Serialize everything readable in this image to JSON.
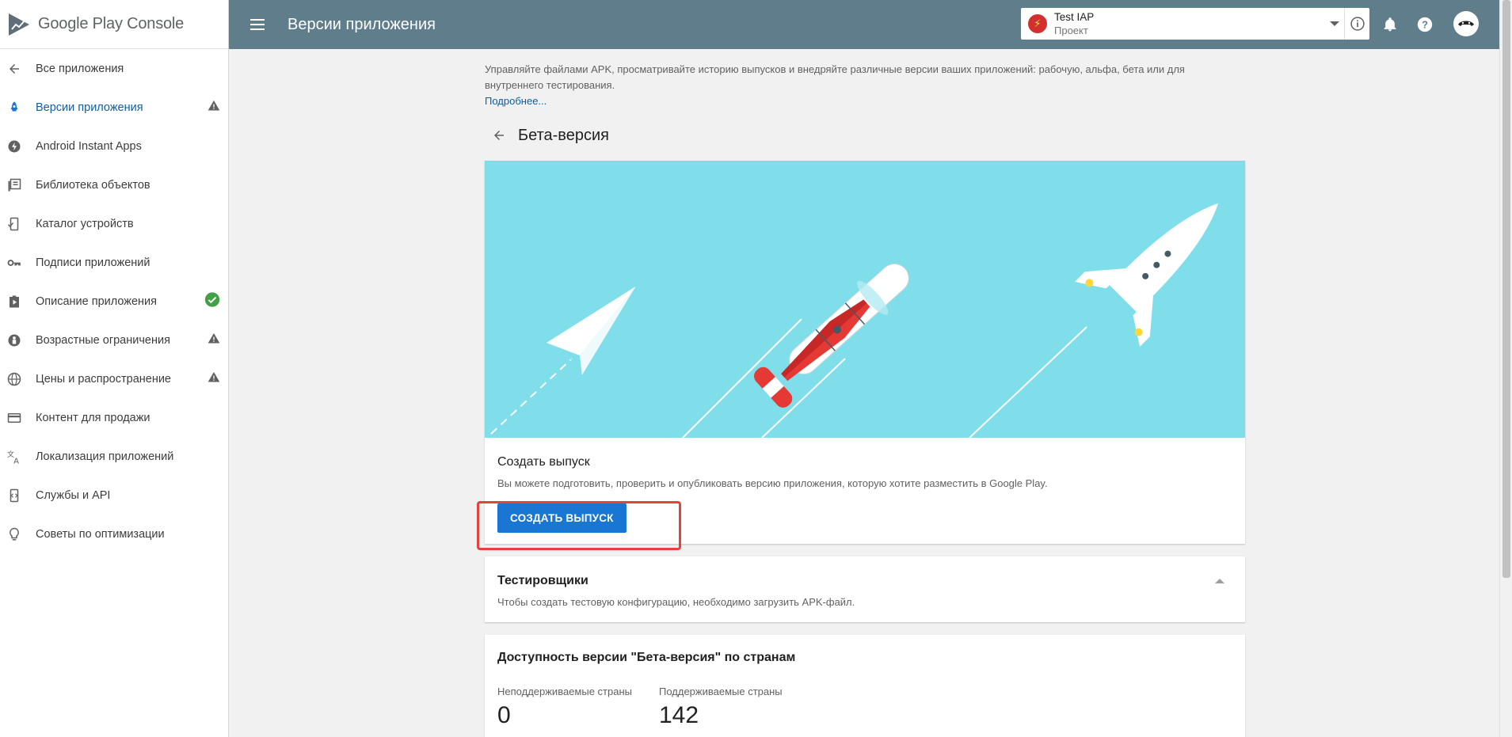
{
  "app": {
    "logo_text": "Google Play Console"
  },
  "topbar": {
    "title": "Версии приложения"
  },
  "project": {
    "name": "Test IAP",
    "subtitle": "Проект"
  },
  "sidebar": {
    "items": [
      {
        "label": "Все приложения",
        "icon": "arrow-left-icon"
      },
      {
        "label": "Версии приложения",
        "icon": "rocket-icon",
        "status": "warning"
      },
      {
        "label": "Android Instant Apps",
        "icon": "bolt-icon"
      },
      {
        "label": "Библиотека объектов",
        "icon": "library-icon"
      },
      {
        "label": "Каталог устройств",
        "icon": "device-check-icon"
      },
      {
        "label": "Подписи приложений",
        "icon": "key-icon"
      },
      {
        "label": "Описание приложения",
        "icon": "store-listing-icon",
        "status": "ok"
      },
      {
        "label": "Возрастные ограничения",
        "icon": "content-rating-icon",
        "status": "warning"
      },
      {
        "label": "Цены и распространение",
        "icon": "globe-icon",
        "status": "warning"
      },
      {
        "label": "Контент для продажи",
        "icon": "credit-card-icon"
      },
      {
        "label": "Локализация приложений",
        "icon": "translate-icon"
      },
      {
        "label": "Службы и API",
        "icon": "services-icon"
      },
      {
        "label": "Советы по оптимизации",
        "icon": "lightbulb-icon"
      }
    ]
  },
  "main": {
    "intro": "Управляйте файлами APK, просматривайте историю выпусков и внедряйте различные версии ваших приложений: рабочую, альфа, бета или для внутреннего тестирования.",
    "more_link": "Подробнее...",
    "page_title": "Бета-версия",
    "release": {
      "title": "Создать выпуск",
      "description": "Вы можете подготовить, проверить и опубликовать версию приложения, которую хотите разместить в Google Play.",
      "button": "Создать выпуск"
    },
    "testers": {
      "title": "Тестировщики",
      "description": "Чтобы создать тестовую конфигурацию, необходимо загрузить APK-файл."
    },
    "availability": {
      "title": "Доступность версии \"Бета-версия\" по странам",
      "unsupported_label": "Неподдерживаемые страны",
      "unsupported_value": "0",
      "supported_label": "Поддерживаемые страны",
      "supported_value": "142"
    }
  },
  "colors": {
    "topbar": "#607d8b",
    "accent": "#1976d2",
    "hero_bg": "#80deea",
    "highlight": "#e0443c",
    "ok": "#43a047",
    "warning": "#616161"
  }
}
